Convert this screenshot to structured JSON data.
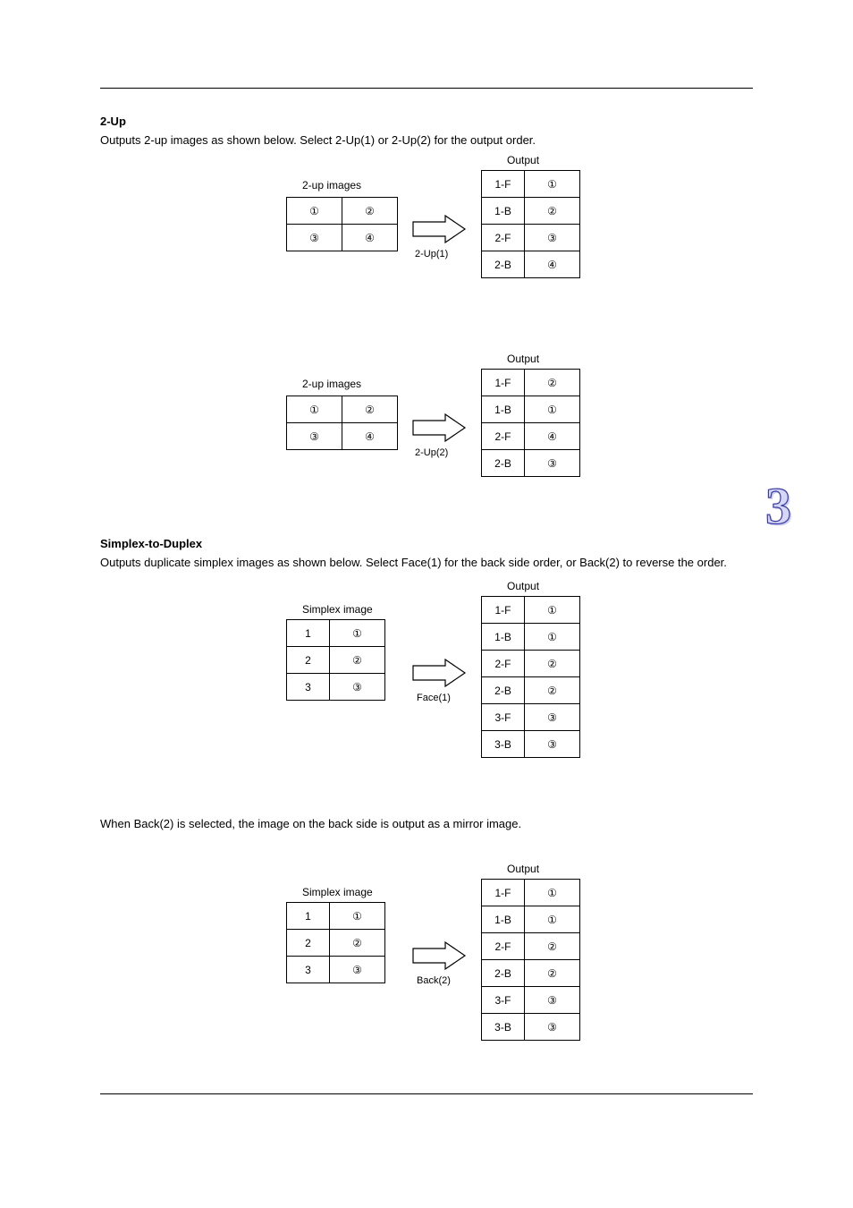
{
  "section1": {
    "title": "2-Up",
    "body": "Outputs 2-up images as shown below. Select 2-Up(1) or 2-Up(2) for the output order.",
    "left": {
      "title": "2-up images",
      "rows": [
        [
          "①",
          "②"
        ],
        [
          "③",
          "④"
        ]
      ]
    },
    "right": {
      "title": "Output",
      "rows": [
        [
          "1-F",
          "①"
        ],
        [
          "1-B",
          "②"
        ],
        [
          "2-F",
          "③"
        ],
        [
          "2-B",
          "④"
        ]
      ]
    },
    "arrow_label": "2-Up(1)"
  },
  "section2": {
    "left": {
      "title": "2-up images",
      "rows": [
        [
          "①",
          "②"
        ],
        [
          "③",
          "④"
        ]
      ]
    },
    "right": {
      "title": "Output",
      "rows": [
        [
          "1-F",
          "②"
        ],
        [
          "1-B",
          "①"
        ],
        [
          "2-F",
          "④"
        ],
        [
          "2-B",
          "③"
        ]
      ]
    },
    "arrow_label": "2-Up(2)"
  },
  "section3": {
    "title": "Simplex-to-Duplex",
    "body": "Outputs duplicate simplex images as shown below. Select Face(1) for the back side order, or Back(2) to reverse the order.",
    "left": {
      "title": "Simplex image",
      "rows": [
        [
          "1",
          "①"
        ],
        [
          "2",
          "②"
        ],
        [
          "3",
          "③"
        ]
      ]
    },
    "right": {
      "title": "Output",
      "rows": [
        [
          "1-F",
          "①"
        ],
        [
          "1-B",
          "①"
        ],
        [
          "2-F",
          "②"
        ],
        [
          "2-B",
          "②"
        ],
        [
          "3-F",
          "③"
        ],
        [
          "3-B",
          "③"
        ]
      ]
    },
    "arrow_label": "Face(1)"
  },
  "section4": {
    "body": "When Back(2) is selected, the image on the back side is output as a mirror image.",
    "left": {
      "title": "Simplex image",
      "rows": [
        [
          "1",
          "①"
        ],
        [
          "2",
          "②"
        ],
        [
          "3",
          "③"
        ]
      ]
    },
    "right": {
      "title": "Output",
      "rows": [
        [
          "1-F",
          "①"
        ],
        [
          "1-B",
          "①"
        ],
        [
          "2-F",
          "②"
        ],
        [
          "2-B",
          "②"
        ],
        [
          "3-F",
          "③"
        ],
        [
          "3-B",
          "③"
        ]
      ]
    },
    "arrow_label": "Back(2)"
  },
  "chapter_badge": "3",
  "glyphs": {
    "c1": "①",
    "c2": "②",
    "c3": "③",
    "c4": "④"
  }
}
